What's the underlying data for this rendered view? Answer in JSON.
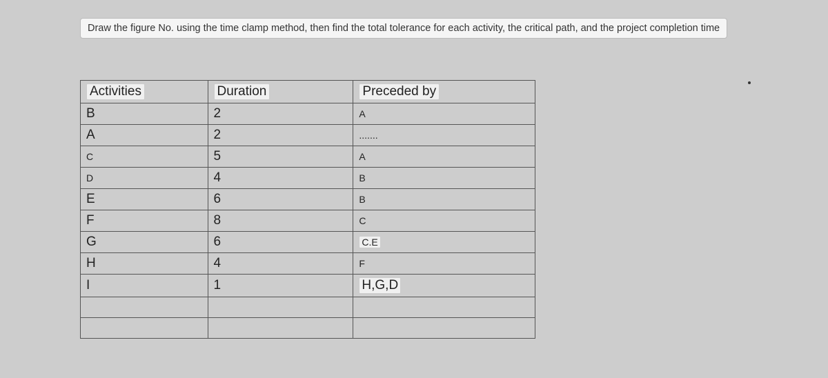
{
  "prompt": "Draw the figure No. using the time clamp method, then find the total tolerance for each activity, the critical path, and the project completion time",
  "table": {
    "headers": [
      "Activities",
      "Duration",
      "Preceded by"
    ],
    "rows": [
      {
        "activity": "B",
        "duration": "2",
        "preceded": "A",
        "sizeA": "lg",
        "sizeD": "lg",
        "sizeP": "sm",
        "hlA": false,
        "hlP": false
      },
      {
        "activity": "A",
        "duration": "2",
        "preceded": ".......",
        "sizeA": "lg",
        "sizeD": "lg",
        "sizeP": "sm",
        "hlA": false,
        "hlP": false
      },
      {
        "activity": "C",
        "duration": "5",
        "preceded": "A",
        "sizeA": "sm",
        "sizeD": "lg",
        "sizeP": "sm",
        "hlA": false,
        "hlP": false
      },
      {
        "activity": "D",
        "duration": "4",
        "preceded": "B",
        "sizeA": "sm",
        "sizeD": "lg",
        "sizeP": "sm",
        "hlA": false,
        "hlP": false
      },
      {
        "activity": "E",
        "duration": "6",
        "preceded": "B",
        "sizeA": "lg",
        "sizeD": "lg",
        "sizeP": "sm",
        "hlA": false,
        "hlP": false
      },
      {
        "activity": "F",
        "duration": "8",
        "preceded": "C",
        "sizeA": "lg",
        "sizeD": "lg",
        "sizeP": "sm",
        "hlA": false,
        "hlP": false
      },
      {
        "activity": "G",
        "duration": "6",
        "preceded": "C.E",
        "sizeA": "lg",
        "sizeD": "lg",
        "sizeP": "sm",
        "hlA": false,
        "hlP": true
      },
      {
        "activity": "H",
        "duration": "4",
        "preceded": "F",
        "sizeA": "lg",
        "sizeD": "lg",
        "sizeP": "sm",
        "hlA": false,
        "hlP": false
      },
      {
        "activity": "I",
        "duration": "1",
        "preceded": "H,G,D",
        "sizeA": "lg",
        "sizeD": "lg",
        "sizeP": "lg",
        "hlA": false,
        "hlP": true
      },
      {
        "activity": "",
        "duration": "",
        "preceded": "",
        "sizeA": "lg",
        "sizeD": "lg",
        "sizeP": "lg",
        "hlA": false,
        "hlP": false
      },
      {
        "activity": "",
        "duration": "",
        "preceded": "",
        "sizeA": "lg",
        "sizeD": "lg",
        "sizeP": "lg",
        "hlA": false,
        "hlP": false
      }
    ]
  },
  "chart_data": {
    "type": "table",
    "title": "Activity precedence table for network diagram / critical path",
    "columns": [
      "Activity",
      "Duration",
      "Preceded by"
    ],
    "rows": [
      [
        "B",
        2,
        "A"
      ],
      [
        "A",
        2,
        null
      ],
      [
        "C",
        5,
        "A"
      ],
      [
        "D",
        4,
        "B"
      ],
      [
        "E",
        6,
        "B"
      ],
      [
        "F",
        8,
        "C"
      ],
      [
        "G",
        6,
        "C,E"
      ],
      [
        "H",
        4,
        "F"
      ],
      [
        "I",
        1,
        "H,G,D"
      ]
    ]
  }
}
